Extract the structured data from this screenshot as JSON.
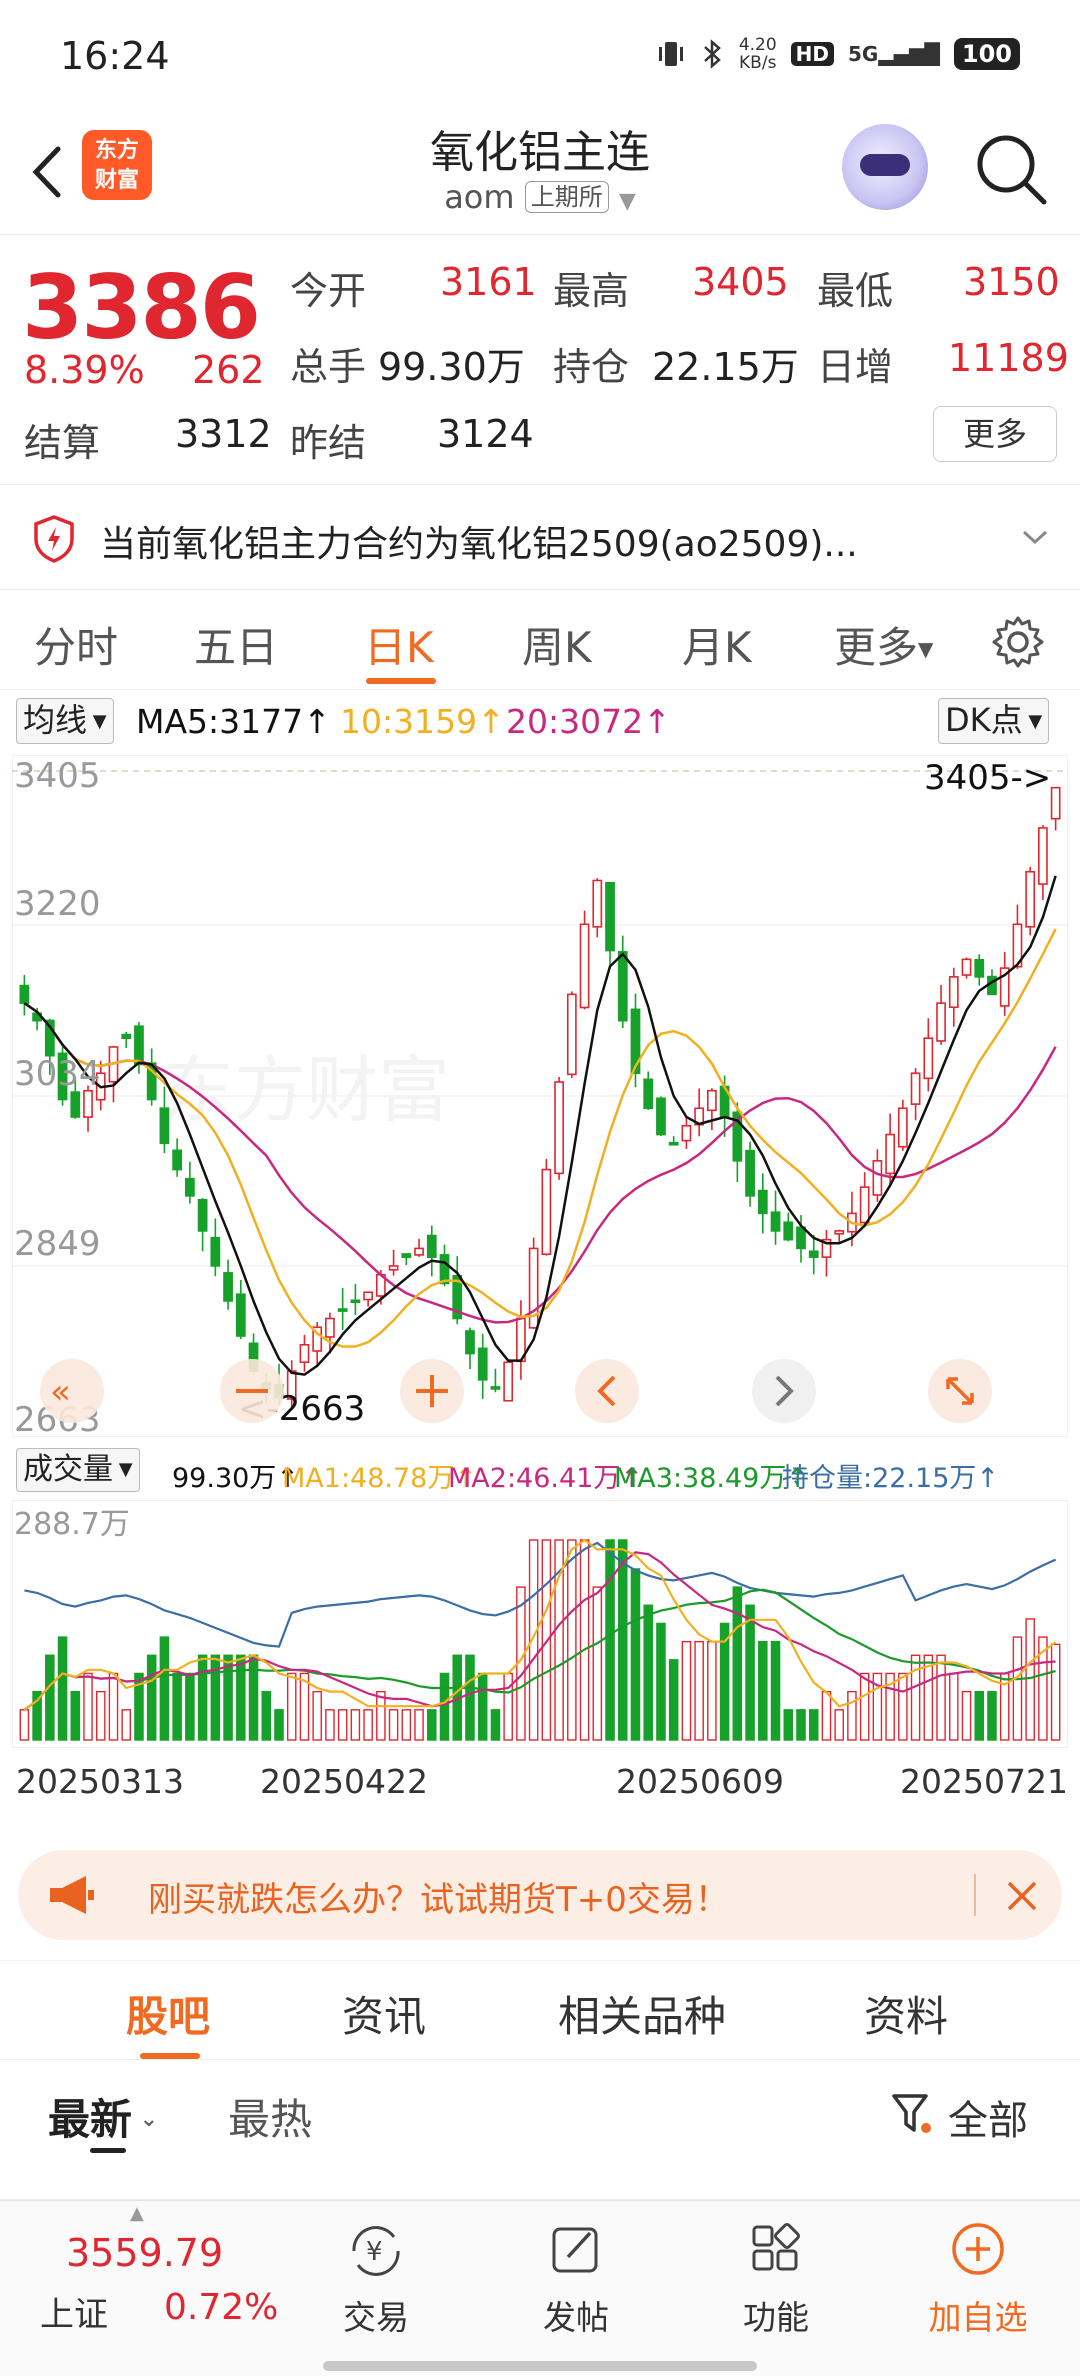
{
  "status": {
    "time": "16:24",
    "net_speed_value": "4.20",
    "net_speed_unit": "KB/s",
    "hd": "HD",
    "signal": "5G",
    "battery": "100"
  },
  "header": {
    "title": "氧化铝主连",
    "code": "aom",
    "exchange": "上期所",
    "brand_line1": "东方",
    "brand_line2": "财富"
  },
  "quote": {
    "price": "3386",
    "change_pct": "8.39%",
    "change": "262",
    "settle_label": "结算",
    "settle": "3312",
    "prev_settle_label": "昨结",
    "prev_settle": "3124",
    "open_label": "今开",
    "open": "3161",
    "high_label": "最高",
    "high": "3405",
    "low_label": "最低",
    "low": "3150",
    "volume_label": "总手",
    "volume": "99.30万",
    "oi_label": "持仓",
    "oi": "22.15万",
    "daily_add_label": "日增",
    "daily_add": "11189",
    "more": "更多"
  },
  "notice": {
    "text": "当前氧化铝主力合约为氧化铝2509(ao2509)..."
  },
  "chart_tabs": [
    "分时",
    "五日",
    "日K",
    "周K",
    "月K",
    "更多"
  ],
  "chart_tab_active": 2,
  "ma": {
    "selector": "均线",
    "ma5": "MA5:3177↑",
    "ma10": "10:3159↑",
    "ma20": "20:3072↑",
    "dk": "DK点",
    "color_ma5": "#111111",
    "color_ma10": "#f0b020",
    "color_ma20": "#c8287f"
  },
  "price_axis": {
    "t1": "3405",
    "t2": "3220",
    "t3": "3034",
    "t4": "2849",
    "t5": "2663"
  },
  "annotations": {
    "high": "3405->",
    "low": "<-2663"
  },
  "volume_panel": {
    "selector": "成交量",
    "vol": "99.30万↑",
    "ma1": "MA1:48.78万↑",
    "ma2": "MA2:46.41万↑",
    "ma3": "MA3:38.49万↑",
    "oi": "持仓量:22.15万↑",
    "axis_max": "288.7万"
  },
  "dates": [
    "20250313",
    "20250422",
    "20250609",
    "20250721"
  ],
  "ad": {
    "text": "刚买就跌怎么办？试试期货T+0交易！"
  },
  "section_tabs": [
    "股吧",
    "资讯",
    "相关品种",
    "资料"
  ],
  "section_tab_active": 0,
  "sort": {
    "latest": "最新",
    "hot": "最热",
    "filter": "全部"
  },
  "bottom": {
    "index_value": "3559.79",
    "index_name": "上证",
    "index_change": "0.72%",
    "trade": "交易",
    "post": "发帖",
    "func": "功能",
    "add": "加自选"
  },
  "chart_data": {
    "type": "candlestick",
    "x_start": "20250313",
    "x_end": "20250723",
    "y_range": [
      2663,
      3405
    ],
    "close_series": [
      3140,
      3120,
      3080,
      3030,
      3010,
      3040,
      3060,
      3090,
      3100,
      3070,
      3030,
      2980,
      2950,
      2920,
      2880,
      2840,
      2800,
      2760,
      2720,
      2700,
      2690,
      2720,
      2750,
      2770,
      2780,
      2790,
      2800,
      2810,
      2830,
      2840,
      2850,
      2860,
      2850,
      2820,
      2780,
      2740,
      2710,
      2700,
      2730,
      2780,
      2860,
      2950,
      3050,
      3150,
      3230,
      3280,
      3200,
      3120,
      3060,
      3020,
      2990,
      2980,
      3000,
      3020,
      3040,
      3010,
      2960,
      2920,
      2900,
      2880,
      2870,
      2860,
      2850,
      2870,
      2880,
      2900,
      2930,
      2960,
      2990,
      3020,
      3060,
      3100,
      3140,
      3170,
      3190,
      3170,
      3150,
      3180,
      3230,
      3290,
      3340,
      3386
    ]
  }
}
